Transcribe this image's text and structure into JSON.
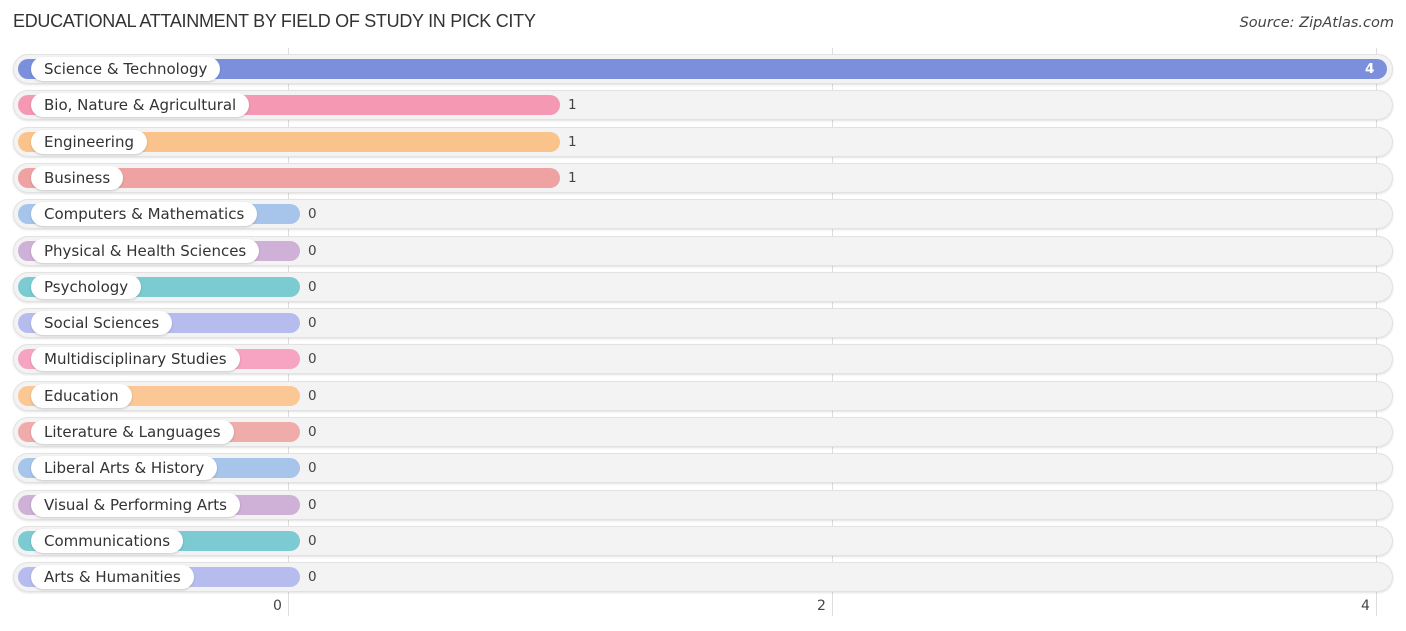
{
  "header": {
    "title": "EDUCATIONAL ATTAINMENT BY FIELD OF STUDY IN PICK CITY",
    "source": "Source: ZipAtlas.com"
  },
  "chart_data": {
    "type": "bar",
    "orientation": "horizontal",
    "title": "EDUCATIONAL ATTAINMENT BY FIELD OF STUDY IN PICK CITY",
    "source": "Source: ZipAtlas.com",
    "xlabel": "",
    "ylabel": "",
    "xlim": [
      0,
      4
    ],
    "x_ticks": [
      "0",
      "2",
      "4"
    ],
    "grid": true,
    "categories": [
      "Science & Technology",
      "Bio, Nature & Agricultural",
      "Engineering",
      "Business",
      "Computers & Mathematics",
      "Physical & Health Sciences",
      "Psychology",
      "Social Sciences",
      "Multidisciplinary Studies",
      "Education",
      "Literature & Languages",
      "Liberal Arts & History",
      "Visual & Performing Arts",
      "Communications",
      "Arts & Humanities"
    ],
    "values": [
      4,
      1,
      1,
      1,
      0,
      0,
      0,
      0,
      0,
      0,
      0,
      0,
      0,
      0,
      0
    ],
    "value_labels": [
      "4",
      "1",
      "1",
      "1",
      "0",
      "0",
      "0",
      "0",
      "0",
      "0",
      "0",
      "0",
      "0",
      "0",
      "0"
    ],
    "colors": [
      "#7b8fdd",
      "#f598b4",
      "#fbc38c",
      "#eea3a2",
      "#a7c4ea",
      "#cfb0d6",
      "#7ccbd2",
      "#b6bdee",
      "#f7a4c2",
      "#fbc895",
      "#efacab",
      "#a7c4ea",
      "#cfb0d6",
      "#7ccbd2",
      "#b6bdee"
    ]
  }
}
